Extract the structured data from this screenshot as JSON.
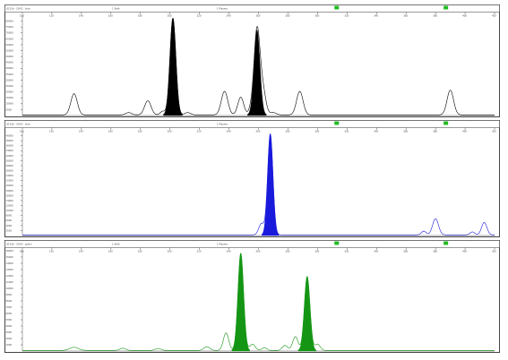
{
  "chart_data": [
    {
      "type": "line",
      "header": {
        "left": "Q1S1b - CHX1 - blue",
        "center_left": "1 Stelt",
        "center_right": "1 Plasma"
      },
      "x_ticks": [
        "100",
        "120",
        "140",
        "160",
        "180",
        "200",
        "220",
        "240",
        "260",
        "280",
        "300",
        "320",
        "340",
        "360",
        "380",
        "400",
        "420",
        "440"
      ],
      "y_ticks": [
        "5000",
        "10000",
        "15000",
        "20000",
        "25000",
        "30000",
        "35000",
        "40000",
        "45000",
        "50000",
        "55000",
        "60000",
        "65000",
        "70000",
        "75000",
        "80000"
      ],
      "xlim": [
        100,
        420
      ],
      "ylim": [
        0,
        85000
      ],
      "marker_positions": [
        313,
        387
      ],
      "peaks": [
        {
          "x": 135,
          "height": 18000,
          "width": 2.2,
          "filled": false
        },
        {
          "x": 172,
          "height": 2000,
          "width": 2.0,
          "filled": false
        },
        {
          "x": 185,
          "height": 12000,
          "width": 2.2,
          "filled": false
        },
        {
          "x": 195,
          "height": 3000,
          "width": 1.6,
          "filled": false
        },
        {
          "x": 202,
          "height": 82000,
          "width": 2.0,
          "filled": true
        },
        {
          "x": 212,
          "height": 2000,
          "width": 2.0,
          "filled": false
        },
        {
          "x": 237,
          "height": 20000,
          "width": 2.2,
          "filled": false
        },
        {
          "x": 248,
          "height": 15000,
          "width": 2.0,
          "filled": false
        },
        {
          "x": 255,
          "height": 5000,
          "width": 1.6,
          "filled": false
        },
        {
          "x": 259,
          "height": 72000,
          "width": 2.0,
          "filled": true
        },
        {
          "x": 263,
          "height": 20000,
          "width": 2.0,
          "filled": false
        },
        {
          "x": 270,
          "height": 2000,
          "width": 2.0,
          "filled": false
        },
        {
          "x": 288,
          "height": 20000,
          "width": 2.2,
          "filled": false
        },
        {
          "x": 390,
          "height": 21000,
          "width": 2.2,
          "filled": false
        }
      ],
      "color": "#000000"
    },
    {
      "type": "line",
      "header": {
        "left": "Q1S1b - CHX2 - blue",
        "center_left": "",
        "center_right": "1 Plasma"
      },
      "x_ticks": [
        "100",
        "120",
        "140",
        "160",
        "180",
        "200",
        "220",
        "240",
        "260",
        "280",
        "300",
        "320",
        "340",
        "360",
        "380",
        "400",
        "420",
        "440"
      ],
      "y_ticks": [
        "2000",
        "4000",
        "6000",
        "8000",
        "10000",
        "12000",
        "14000",
        "16000",
        "18000",
        "20000",
        "22000",
        "24000",
        "26000",
        "28000",
        "30000",
        "32000",
        "34000",
        "36000",
        "38000",
        "40000"
      ],
      "xlim": [
        100,
        420
      ],
      "ylim": [
        0,
        42000
      ],
      "marker_positions": [
        313,
        387
      ],
      "peaks": [
        {
          "x": 262,
          "height": 4500,
          "width": 1.8,
          "filled": false
        },
        {
          "x": 268,
          "height": 40500,
          "width": 1.8,
          "filled": true
        },
        {
          "x": 372,
          "height": 1500,
          "width": 1.6,
          "filled": false
        },
        {
          "x": 380,
          "height": 6500,
          "width": 2.0,
          "filled": false
        },
        {
          "x": 405,
          "height": 1200,
          "width": 1.6,
          "filled": false
        },
        {
          "x": 413,
          "height": 5000,
          "width": 1.8,
          "filled": false
        }
      ],
      "color": "#1a1adc"
    },
    {
      "type": "line",
      "header": {
        "left": "Q1S1b - CHX3 - green",
        "center_left": "1 Stelt",
        "center_right": "1 Plasma"
      },
      "x_ticks": [
        "100",
        "120",
        "140",
        "160",
        "180",
        "200",
        "220",
        "240",
        "260",
        "280",
        "300",
        "320",
        "340",
        "360",
        "380",
        "400",
        "420",
        "440"
      ],
      "y_ticks": [
        "1000",
        "2000",
        "3000",
        "4000",
        "5000",
        "6000",
        "7000",
        "8000",
        "9000",
        "10000",
        "11000",
        "12000",
        "13000",
        "14000",
        "15000",
        "16000"
      ],
      "xlim": [
        100,
        420
      ],
      "ylim": [
        0,
        16000
      ],
      "marker_positions": [
        313,
        387
      ],
      "peaks": [
        {
          "x": 135,
          "height": 500,
          "width": 3.0,
          "filled": false
        },
        {
          "x": 168,
          "height": 350,
          "width": 2.0,
          "filled": false
        },
        {
          "x": 192,
          "height": 300,
          "width": 2.0,
          "filled": false
        },
        {
          "x": 225,
          "height": 600,
          "width": 2.0,
          "filled": false
        },
        {
          "x": 238,
          "height": 2800,
          "width": 1.8,
          "filled": false
        },
        {
          "x": 248,
          "height": 15500,
          "width": 1.9,
          "filled": true
        },
        {
          "x": 256,
          "height": 1000,
          "width": 1.8,
          "filled": false
        },
        {
          "x": 264,
          "height": 450,
          "width": 1.6,
          "filled": false
        },
        {
          "x": 278,
          "height": 800,
          "width": 1.8,
          "filled": false
        },
        {
          "x": 285,
          "height": 2200,
          "width": 1.8,
          "filled": false
        },
        {
          "x": 293,
          "height": 11800,
          "width": 1.9,
          "filled": true
        },
        {
          "x": 300,
          "height": 1000,
          "width": 1.8,
          "filled": false
        }
      ],
      "color": "#149614"
    }
  ]
}
